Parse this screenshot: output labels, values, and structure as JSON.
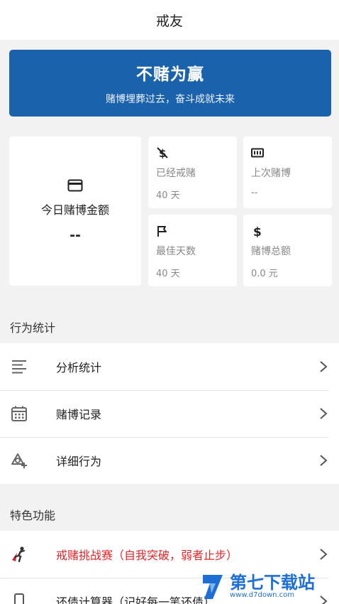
{
  "header": {
    "title": "戒友"
  },
  "banner": {
    "title": "不赌为赢",
    "subtitle": "赌博埋葬过去，奋斗成就未来"
  },
  "stats": {
    "today": {
      "label": "今日赌博金额",
      "value": "--",
      "icon": "card-icon"
    },
    "quit_days": {
      "label": "已经戒赌",
      "value": "40 天",
      "icon": "money-off-icon"
    },
    "last_gamble": {
      "label": "上次赌博",
      "value": "--",
      "icon": "banknote-icon"
    },
    "best_days": {
      "label": "最佳天数",
      "value": "40 天",
      "icon": "flag-icon"
    },
    "total": {
      "label": "赌博总额",
      "value": "0.0 元",
      "icon": "dollar-icon"
    }
  },
  "behavior": {
    "title": "行为统计",
    "items": [
      {
        "label": "分析统计",
        "icon": "list-lines-icon"
      },
      {
        "label": "赌博记录",
        "icon": "calendar-icon"
      },
      {
        "label": "详细行为",
        "icon": "shapes-add-icon"
      }
    ]
  },
  "features": {
    "title": "特色功能",
    "items": [
      {
        "label": "戒赌挑战赛（自我突破，弱者止步）",
        "icon": "hero-icon",
        "color": "#e5262a"
      },
      {
        "label": "还债计算器（记好每一笔还债）",
        "icon": "phone-icon"
      }
    ]
  },
  "watermark": {
    "text": "第七下载站",
    "url": "www.d7down.com"
  },
  "colors": {
    "banner": "#1b62ad",
    "accent_red": "#e5262a",
    "watermark": "#1d6fd6"
  }
}
